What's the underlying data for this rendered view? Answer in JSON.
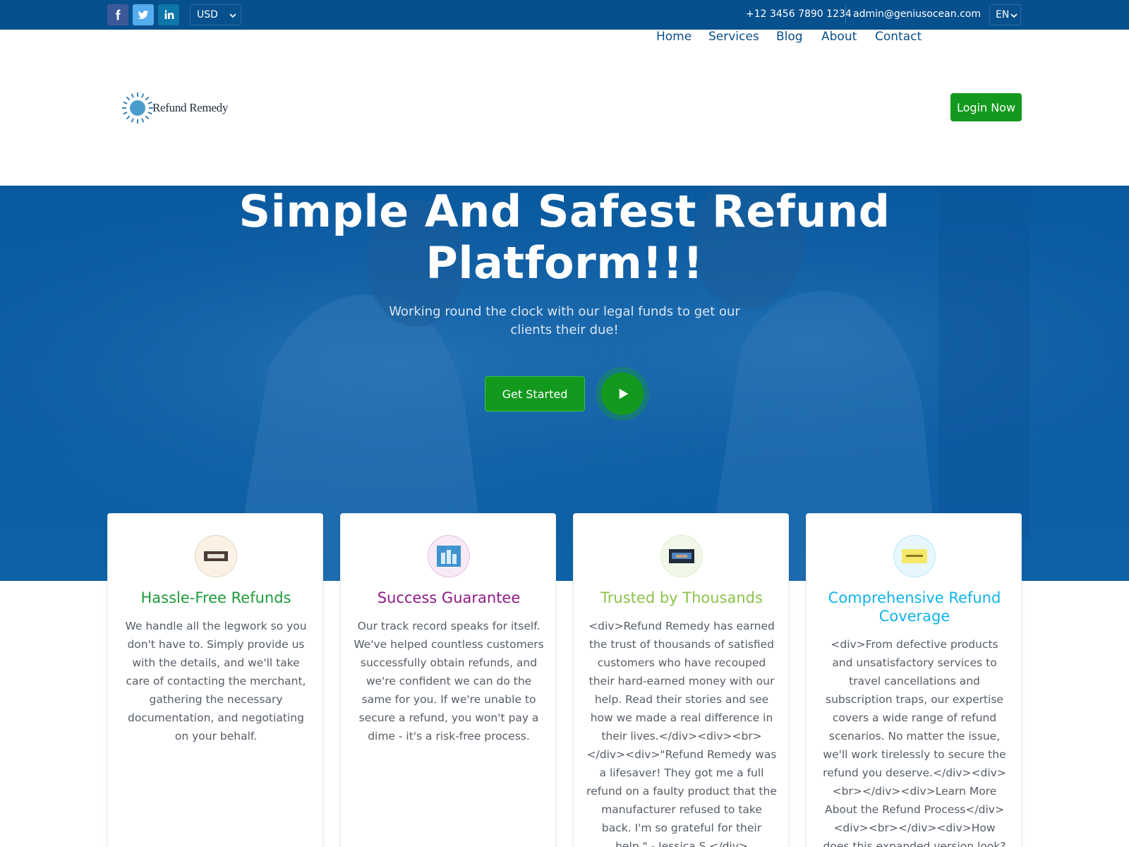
{
  "topbar": {
    "currency": "USD",
    "phone": "+12 3456 7890 1234",
    "email": "admin@geniusocean.com",
    "language": "EN",
    "social": [
      "facebook-icon",
      "twitter-icon",
      "linkedin-icon"
    ]
  },
  "header": {
    "logo_text": "Refund Remedy",
    "nav": [
      "Home",
      "Services",
      "Blog",
      "About",
      "Contact"
    ],
    "login_label": "Login Now"
  },
  "hero": {
    "title_line1": "Simple And Safest Refund",
    "title_line2": "Platform!!!",
    "subtitle": "Working round the clock with our legal funds to get our clients their due!",
    "cta_label": "Get Started"
  },
  "features": [
    {
      "title": "Hassle-Free Refunds",
      "text": "We handle all the legwork so you don't have to. Simply provide us with the details, and we'll take care of contacting the merchant, gathering the necessary documentation, and negotiating on your behalf.",
      "title_color": "#1f9a3c",
      "icon_bg": "#fdf1e5"
    },
    {
      "title": "Success Guarantee",
      "text": "Our track record speaks for itself. We've helped countless customers successfully obtain refunds, and we're confident we can do the same for you. If we're unable to secure a refund, you won't pay a dime - it's a risk-free process.",
      "title_color": "#8e1b86",
      "icon_bg": "#f8e9f7"
    },
    {
      "title": "Trusted by Thousands",
      "text": "<div>Refund Remedy has earned the trust of thousands of satisfied customers who have recouped their hard-earned money with our help. Read their stories and see how we made a real difference in their lives.</div><div><br></div><div>\"Refund Remedy was a lifesaver! They got me a full refund on a faulty product that the manufacturer refused to take back. I'm so grateful for their help.\" - Jessica S.</div>",
      "title_color": "#8bc34a",
      "icon_bg": "#f1f8ea"
    },
    {
      "title": "Comprehensive Refund Coverage",
      "text": "<div>From defective products and unsatisfactory services to travel cancellations and subscription traps, our expertise covers a wide range of refund scenarios. No matter the issue, we'll work tirelessly to secure the refund you deserve.</div><div><br></div><div>Learn More About the Refund Process</div><div><br></div><div>How does this expanded version look? I've added more",
      "title_color": "#10b2e8",
      "icon_bg": "#e7f7fd"
    }
  ]
}
